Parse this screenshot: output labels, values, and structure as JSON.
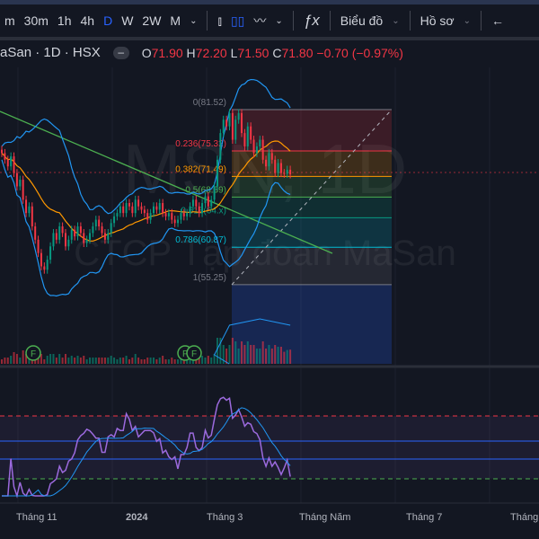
{
  "toolbar": {
    "intervals": [
      "m",
      "30m",
      "1h",
      "4h",
      "D",
      "W",
      "2W",
      "M"
    ],
    "active_interval": "D",
    "chart_type": "Biểu đồ",
    "profile": "Hồ sơ",
    "icons": [
      "chevron-down-icon",
      "bar-chart-icon",
      "candlestick-icon",
      "indicator-icon",
      "chevron-down-icon",
      "fx-icon",
      "arrow-left-icon"
    ]
  },
  "legend": {
    "symbol": "aSan · 1D · HSX",
    "o_label": "O",
    "o": "71.90",
    "h_label": "H",
    "h": "72.20",
    "l_label": "L",
    "l": "71.50",
    "c_label": "C",
    "c": "71.80",
    "change": "−0.70 (−0.97%)"
  },
  "watermark": {
    "ticker": "MSN, 1D",
    "name": "CTCP Tập đoàn MaSan"
  },
  "fib": [
    {
      "label": "0(81.52)",
      "level": 81.52,
      "color": "#787b86"
    },
    {
      "label": "0.236(75.32)",
      "level": 75.32,
      "color": "#f23645"
    },
    {
      "label": "0.382(71.49)",
      "level": 71.49,
      "color": "#ff9800"
    },
    {
      "label": "0.5(68.39)",
      "level": 68.39,
      "color": "#4caf50"
    },
    {
      "label": "0.618(64.x)",
      "level": 65.29,
      "color": "#089981"
    },
    {
      "label": "0.786(60.87)",
      "level": 60.87,
      "color": "#00bcd4"
    },
    {
      "label": "1(55.25)",
      "level": 55.25,
      "color": "#787b86"
    }
  ],
  "closes": [
    75,
    74,
    73,
    74.5,
    72,
    70,
    71,
    68,
    66,
    67,
    64,
    62,
    60,
    58,
    57.5,
    59,
    61,
    63,
    62,
    64,
    63,
    61,
    62,
    63.5,
    62.5,
    64,
    63,
    61.5,
    62,
    63,
    64,
    65,
    64,
    63,
    62,
    63,
    64.5,
    65.5,
    66,
    67,
    66,
    67.5,
    67,
    66,
    68,
    67,
    66.5,
    66,
    65,
    66,
    67,
    66.5,
    67.5,
    66,
    65.5,
    66,
    65,
    64.5,
    65,
    66,
    65.5,
    66,
    67,
    68,
    67,
    66,
    67.5,
    68.5,
    67,
    68,
    70,
    74,
    78,
    80,
    79,
    81,
    77,
    80,
    81,
    78,
    76,
    79,
    77,
    75,
    76,
    77,
    74,
    73,
    75,
    74,
    72,
    73.5,
    72,
    71.9,
    72.5,
    71.8
  ],
  "axis_labels": [
    "Tháng 11",
    "2024",
    "Tháng 3",
    "Tháng Năm",
    "Tháng 7",
    "Tháng"
  ],
  "markers": [
    "F",
    "F",
    "F"
  ],
  "colors": {
    "up": "#089981",
    "down": "#f23645",
    "rsi": "#9c6ade",
    "band": "#2196f3",
    "ma": "#ff9800"
  }
}
